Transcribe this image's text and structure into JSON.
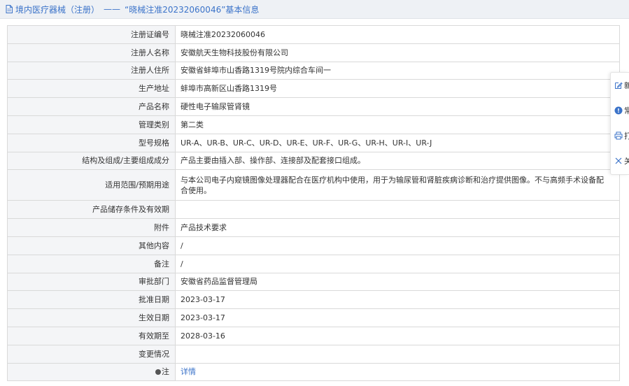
{
  "header": {
    "category": "境内医疗器械（注册）",
    "separator": "——",
    "title": "“晓械注准20232060046”基本信息"
  },
  "rows": [
    {
      "label": "注册证编号",
      "value": "晓械注准20232060046"
    },
    {
      "label": "注册人名称",
      "value": "安徽航天生物科技股份有限公司"
    },
    {
      "label": "注册人住所",
      "value": "安徽省蚌埠市山香路1319号院内综合车间一"
    },
    {
      "label": "生产地址",
      "value": "蚌埠市高新区山香路1319号"
    },
    {
      "label": "产品名称",
      "value": "硬性电子输尿管肾镜"
    },
    {
      "label": "管理类别",
      "value": "第二类"
    },
    {
      "label": "型号规格",
      "value": "UR-A、UR-B、UR-C、UR-D、UR-E、UR-F、UR-G、UR-H、UR-I、UR-J"
    },
    {
      "label": "结构及组成/主要组成成分",
      "value": "产品主要由插入部、操作部、连接部及配套接口组成。"
    },
    {
      "label": "适用范围/预期用途",
      "value": "与本公司电子内窥镜图像处理器配合在医疗机构中使用，用于为输尿管和肾脏疾病诊断和治疗提供图像。不与高频手术设备配合使用。"
    },
    {
      "label": "产品储存条件及有效期",
      "value": ""
    },
    {
      "label": "附件",
      "value": "产品技术要求"
    },
    {
      "label": "其他内容",
      "value": "/"
    },
    {
      "label": "备注",
      "value": "/"
    },
    {
      "label": "审批部门",
      "value": "安徽省药品监督管理局"
    },
    {
      "label": "批准日期",
      "value": "2023-03-17"
    },
    {
      "label": "生效日期",
      "value": "2023-03-17"
    },
    {
      "label": "有效期至",
      "value": "2028-03-16"
    },
    {
      "label": "变更情况",
      "value": ""
    },
    {
      "label": "注",
      "value": "详情"
    }
  ],
  "side_panel": {
    "items": [
      {
        "icon": "edit-icon",
        "text": "新"
      },
      {
        "icon": "help-icon",
        "text": "常"
      },
      {
        "icon": "print-icon",
        "text": "打"
      },
      {
        "icon": "close-icon",
        "text": "关"
      }
    ]
  },
  "colors": {
    "link": "#3b73c9",
    "label_bg": "#f4f5f7",
    "border": "#d9d9d9",
    "header_bg": "#eef1f5"
  }
}
